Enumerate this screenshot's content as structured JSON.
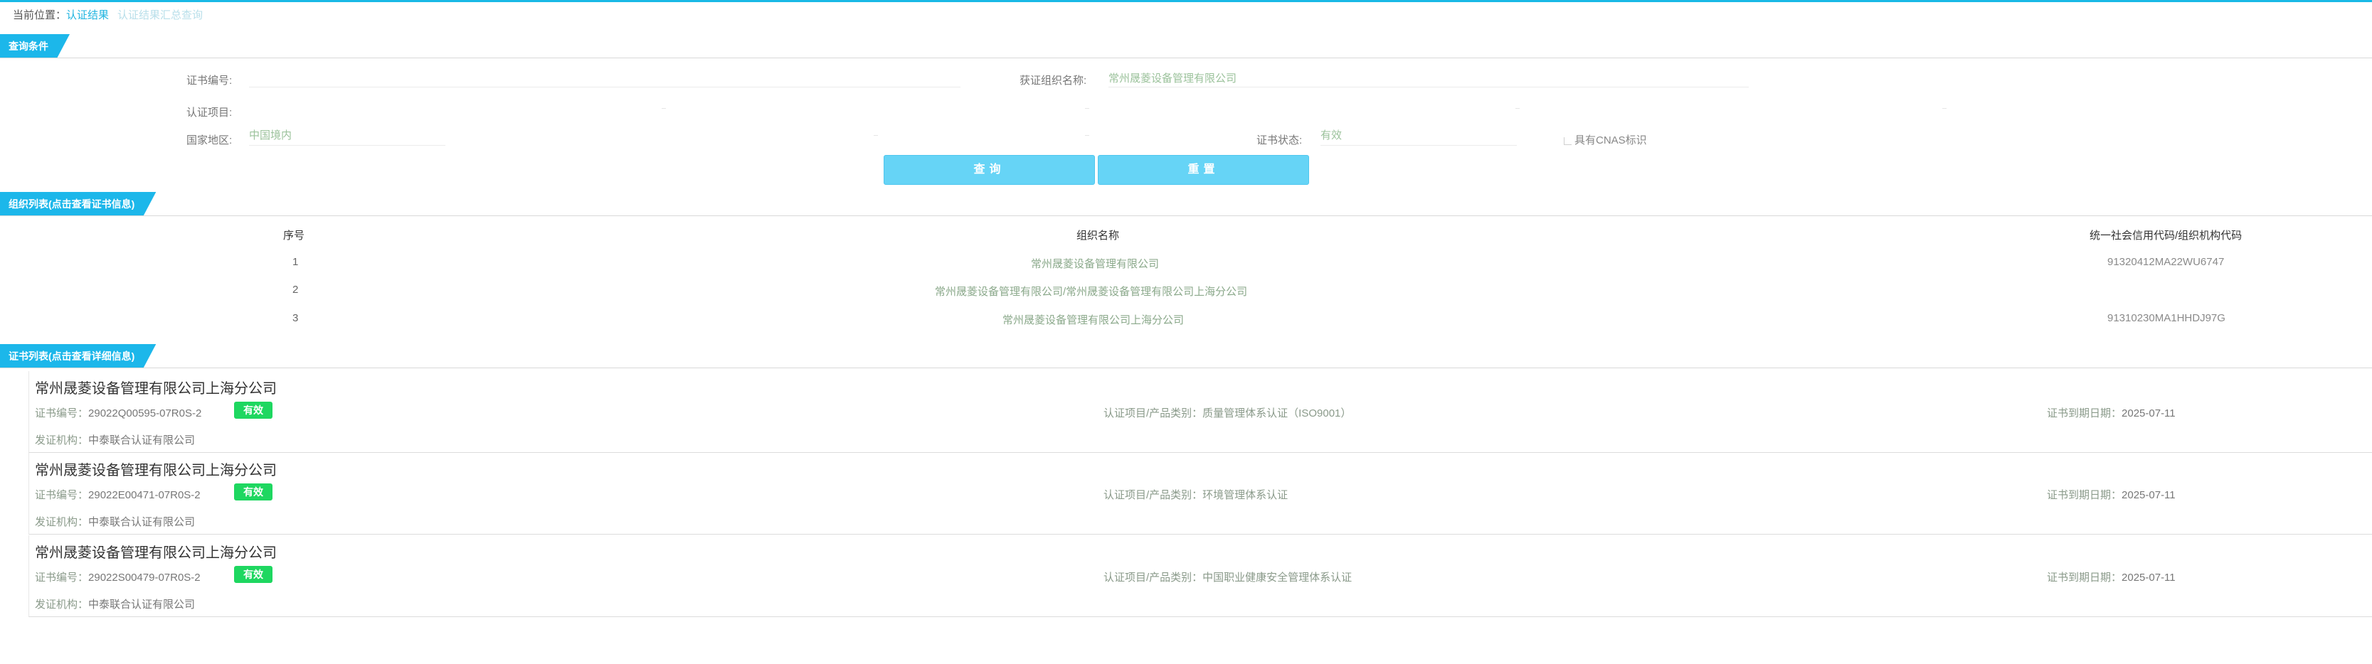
{
  "breadcrumb": {
    "prefix": "当前位置：",
    "crumb1": "认证结果",
    "crumb2": "认证结果汇总查询"
  },
  "query_section": {
    "title": "查询条件",
    "cert_no_label": "证书编号:",
    "cert_no_value": "",
    "org_name_label": "获证组织名称:",
    "org_name_value": "常州晟菱设备管理有限公司",
    "project_label": "认证项目:",
    "region_label": "国家地区:",
    "region_value": "中国境内",
    "status_label": "证书状态:",
    "status_value": "有效",
    "cnas_label": "具有CNAS标识",
    "query_button": "查询",
    "reset_button": "重置"
  },
  "org_section": {
    "title": "组织列表(点击查看证书信息)",
    "columns": [
      "序号",
      "组织名称",
      "统一社会信用代码/组织机构代码"
    ],
    "rows": [
      {
        "idx": "1",
        "name": "常州晟菱设备管理有限公司",
        "code": "91320412MA22WU6747"
      },
      {
        "idx": "2",
        "name": "常州晟菱设备管理有限公司/常州晟菱设备管理有限公司上海分公司",
        "code": ""
      },
      {
        "idx": "3",
        "name": "常州晟菱设备管理有限公司上海分公司",
        "code": "91310230MA1HHDJ97G"
      }
    ]
  },
  "cert_section": {
    "title": "证书列表(点击查看详细信息)",
    "cert_no_label": "证书编号：",
    "project_label": "认证项目/产品类别：",
    "expiry_label": "证书到期日期：",
    "issuer_label": "发证机构：",
    "cards": [
      {
        "name": "常州晟菱设备管理有限公司上海分公司",
        "cert_no": "29022Q00595-07R0S-2",
        "status": "有效",
        "project": "质量管理体系认证（ISO9001）",
        "expiry": "2025-07-11",
        "issuer": "中泰联合认证有限公司"
      },
      {
        "name": "常州晟菱设备管理有限公司上海分公司",
        "cert_no": "29022E00471-07R0S-2",
        "status": "有效",
        "project": "环境管理体系认证",
        "expiry": "2025-07-11",
        "issuer": "中泰联合认证有限公司"
      },
      {
        "name": "常州晟菱设备管理有限公司上海分公司",
        "cert_no": "29022S00479-07R0S-2",
        "status": "有效",
        "project": "中国职业健康安全管理体系认证",
        "expiry": "2025-07-11",
        "issuer": "中泰联合认证有限公司"
      }
    ]
  }
}
